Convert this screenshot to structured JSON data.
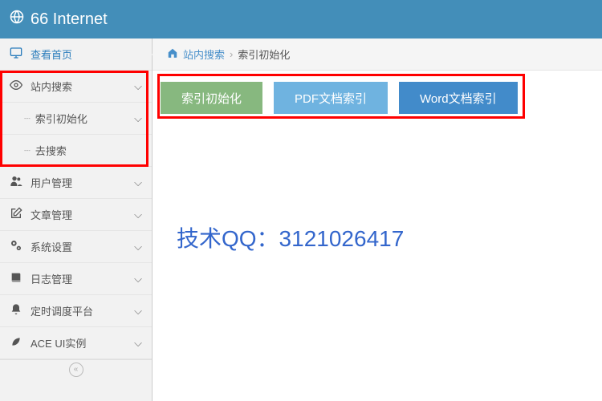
{
  "header": {
    "title": "66 Internet"
  },
  "sidebar": {
    "items": [
      {
        "label": "查看首页"
      },
      {
        "label": "站内搜索"
      },
      {
        "label": "索引初始化"
      },
      {
        "label": "去搜索"
      },
      {
        "label": "用户管理"
      },
      {
        "label": "文章管理"
      },
      {
        "label": "系统设置"
      },
      {
        "label": "日志管理"
      },
      {
        "label": "定时调度平台"
      },
      {
        "label": "ACE UI实例"
      }
    ]
  },
  "breadcrumb": {
    "root": "站内搜索",
    "current": "索引初始化"
  },
  "buttons": {
    "init": "索引初始化",
    "pdf": "PDF文档索引",
    "word": "Word文档索引"
  },
  "watermark": "技术QQ：3121026417"
}
